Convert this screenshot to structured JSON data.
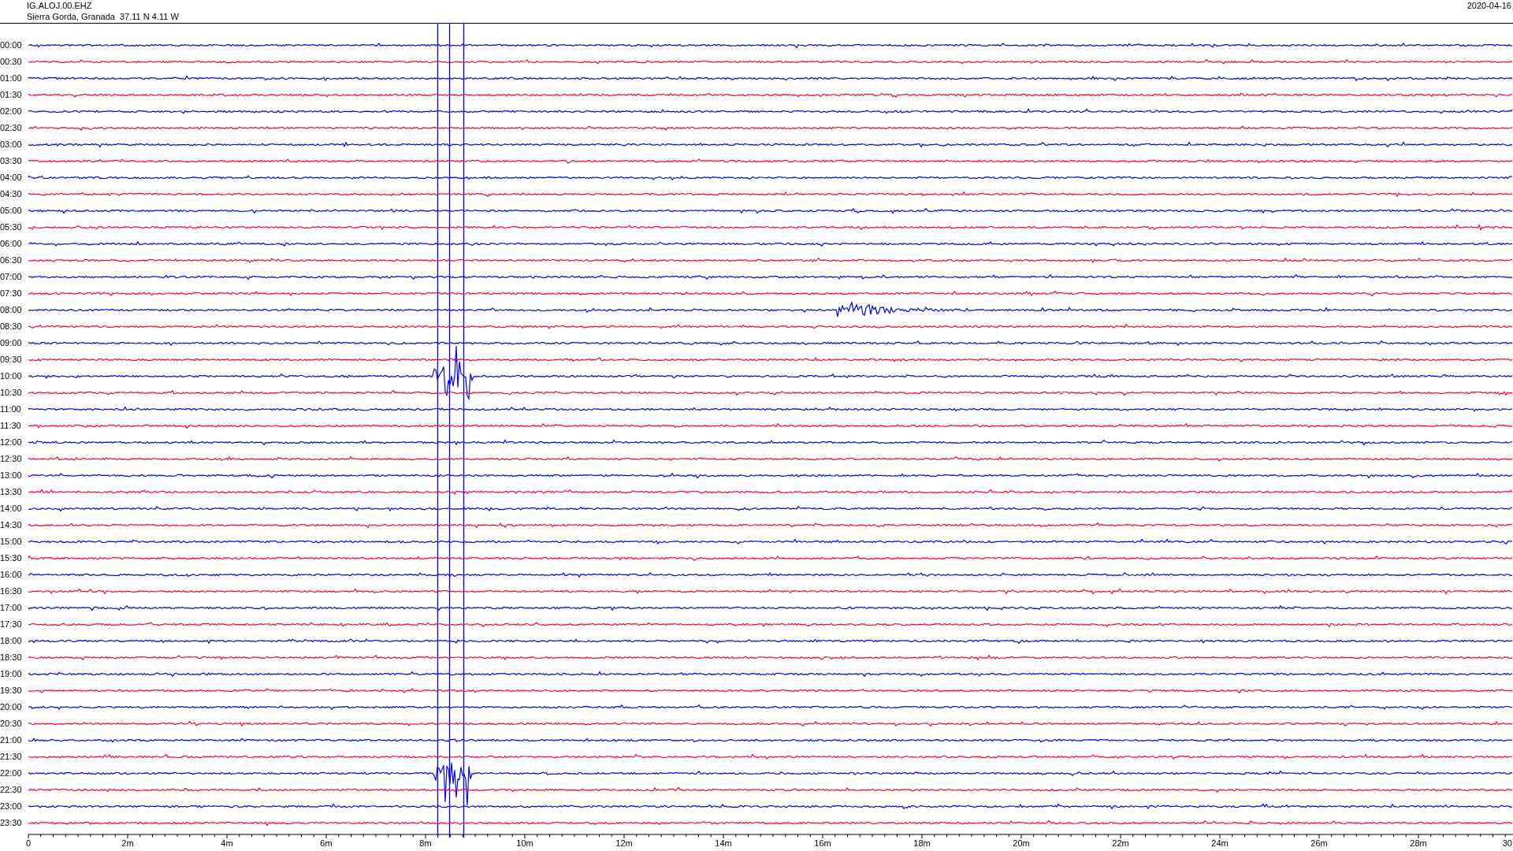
{
  "header": {
    "station": "IG.ALOJ.00.EHZ",
    "location": "Sierra Gorda, Granada  37.11 N 4.11 W",
    "date": "2020-04-16"
  },
  "rows": [
    {
      "time": "00:00",
      "color": "#0000ff"
    },
    {
      "time": "00:30",
      "color": "#ff0033"
    },
    {
      "time": "01:00",
      "color": "#0000ff"
    },
    {
      "time": "01:30",
      "color": "#ff0033"
    },
    {
      "time": "02:00",
      "color": "#0000ff"
    },
    {
      "time": "02:30",
      "color": "#ff0033"
    },
    {
      "time": "03:00",
      "color": "#0000ff"
    },
    {
      "time": "03:30",
      "color": "#ff0033"
    },
    {
      "time": "04:00",
      "color": "#0000ff"
    },
    {
      "time": "04:30",
      "color": "#ff0033"
    },
    {
      "time": "05:00",
      "color": "#0000ff"
    },
    {
      "time": "05:30",
      "color": "#ff0033"
    },
    {
      "time": "06:00",
      "color": "#0000ff"
    },
    {
      "time": "06:30",
      "color": "#ff0033"
    },
    {
      "time": "07:00",
      "color": "#0000ff"
    },
    {
      "time": "07:30",
      "color": "#ff0033"
    },
    {
      "time": "08:00",
      "color": "#0000ff"
    },
    {
      "time": "08:30",
      "color": "#ff0033"
    },
    {
      "time": "09:00",
      "color": "#0000ff"
    },
    {
      "time": "09:30",
      "color": "#ff0033"
    },
    {
      "time": "10:00",
      "color": "#0000ff"
    },
    {
      "time": "10:30",
      "color": "#ff0033"
    },
    {
      "time": "11:00",
      "color": "#0000ff"
    },
    {
      "time": "11:30",
      "color": "#ff0033"
    },
    {
      "time": "12:00",
      "color": "#0000ff"
    },
    {
      "time": "12:30",
      "color": "#ff0033"
    },
    {
      "time": "13:00",
      "color": "#0000ff"
    },
    {
      "time": "13:30",
      "color": "#ff0033"
    },
    {
      "time": "14:00",
      "color": "#0000ff"
    },
    {
      "time": "14:30",
      "color": "#ff0033"
    },
    {
      "time": "15:00",
      "color": "#0000ff"
    },
    {
      "time": "15:30",
      "color": "#ff0033"
    },
    {
      "time": "16:00",
      "color": "#0000ff"
    },
    {
      "time": "16:30",
      "color": "#ff0033"
    },
    {
      "time": "17:00",
      "color": "#0000ff"
    },
    {
      "time": "17:30",
      "color": "#ff0033"
    },
    {
      "time": "18:00",
      "color": "#0000ff"
    },
    {
      "time": "18:30",
      "color": "#ff0033"
    },
    {
      "time": "19:00",
      "color": "#0000ff"
    },
    {
      "time": "19:30",
      "color": "#ff0033"
    },
    {
      "time": "20:00",
      "color": "#0000ff"
    },
    {
      "time": "20:30",
      "color": "#ff0033"
    },
    {
      "time": "21:00",
      "color": "#0000ff"
    },
    {
      "time": "21:30",
      "color": "#ff0033"
    },
    {
      "time": "22:00",
      "color": "#0000ff"
    },
    {
      "time": "22:30",
      "color": "#ff0033"
    },
    {
      "time": "23:00",
      "color": "#0000ff"
    },
    {
      "time": "23:30",
      "color": "#ff0033"
    }
  ],
  "x_axis": {
    "labels": [
      "0",
      "2m",
      "4m",
      "6m",
      "8m",
      "10m",
      "12m",
      "14m",
      "16m",
      "18m",
      "20m",
      "22m",
      "24m",
      "26m",
      "28m",
      "30"
    ]
  }
}
